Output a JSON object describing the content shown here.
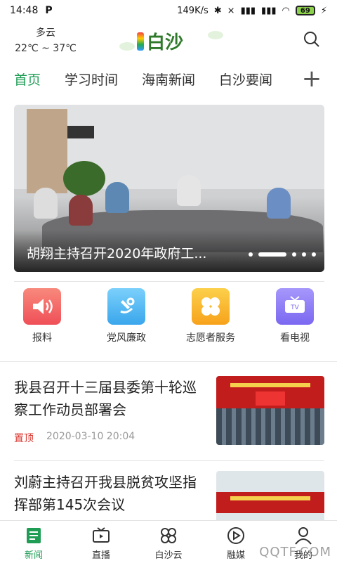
{
  "statusbar": {
    "time": "14:48",
    "app_badge": "P",
    "network_speed": "149K/s",
    "battery_level": "69"
  },
  "header": {
    "weather_condition": "多云",
    "temperature_range": "22℃ ~ 37℃",
    "logo_text": "白沙"
  },
  "tabs": [
    {
      "label": "首页",
      "active": true
    },
    {
      "label": "学习时间",
      "active": false
    },
    {
      "label": "海南新闻",
      "active": false
    },
    {
      "label": "白沙要闻",
      "active": false
    }
  ],
  "add_tab_symbol": "+",
  "banner": {
    "caption": "胡翔主持召开2020年政府工..."
  },
  "shortcuts": [
    {
      "label": "报料",
      "icon": "speaker-icon",
      "color": "#f46a6a"
    },
    {
      "label": "党风廉政",
      "icon": "party-emblem-icon",
      "color": "#57b8f2"
    },
    {
      "label": "志愿者服务",
      "icon": "clover-icon",
      "color": "#f8b526"
    },
    {
      "label": "看电视",
      "icon": "tv-icon",
      "color": "#8b7cf6"
    }
  ],
  "news": [
    {
      "title": "我县召开十三届县委第十轮巡察工作动员部署会",
      "tag": "置顶",
      "time": "2020-03-10 20:04"
    },
    {
      "title": "刘蔚主持召开我县脱贫攻坚指挥部第145次会议",
      "tag": "",
      "time": ""
    }
  ],
  "tabbar": [
    {
      "label": "新闻",
      "icon": "news-icon",
      "active": true
    },
    {
      "label": "直播",
      "icon": "live-tv-icon",
      "active": false
    },
    {
      "label": "白沙云",
      "icon": "cloud-grid-icon",
      "active": false
    },
    {
      "label": "融媒",
      "icon": "media-play-icon",
      "active": false
    },
    {
      "label": "我的",
      "icon": "user-icon",
      "active": false
    }
  ],
  "watermark": "QQTF.COM",
  "colors": {
    "accent": "#1f9d55",
    "pin": "#d9362e"
  }
}
